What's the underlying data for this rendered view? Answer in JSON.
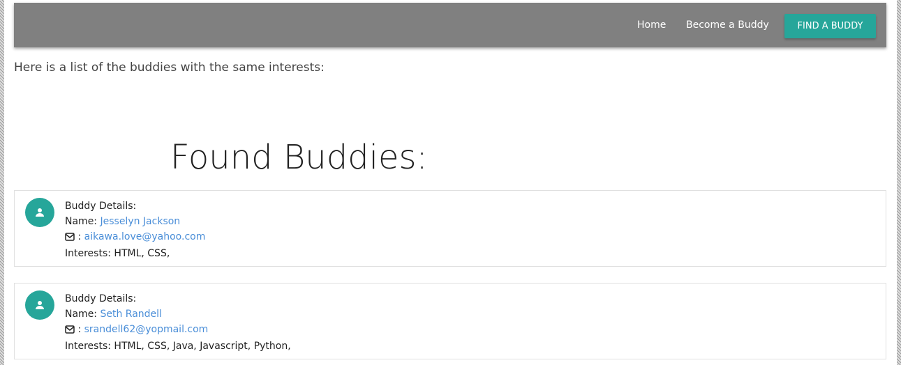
{
  "navbar": {
    "links": [
      {
        "label": "Home"
      },
      {
        "label": "Become a Buddy"
      }
    ],
    "cta_label": "FIND A BUDDY"
  },
  "intro_text": "Here is a list of the buddies with the same interests:",
  "heading": "Found Buddies:",
  "buddies": [
    {
      "details_title": "Buddy Details:",
      "name_label": "Name: ",
      "name": "Jesselyn Jackson",
      "email_separator": " : ",
      "email": "aikawa.love@yahoo.com",
      "interests_label": "Interests: ",
      "interests": "HTML, CSS,"
    },
    {
      "details_title": "Buddy Details:",
      "name_label": "Name: ",
      "name": "Seth Randell",
      "email_separator": " : ",
      "email": "srandell62@yopmail.com",
      "interests_label": "Interests: ",
      "interests": "HTML, CSS, Java, Javascript, Python,"
    }
  ],
  "icons": {
    "avatar": "person-icon",
    "email": "envelope-icon"
  },
  "colors": {
    "navbar": "#808080",
    "accent": "#26a69a",
    "link": "#4a8ed8"
  }
}
